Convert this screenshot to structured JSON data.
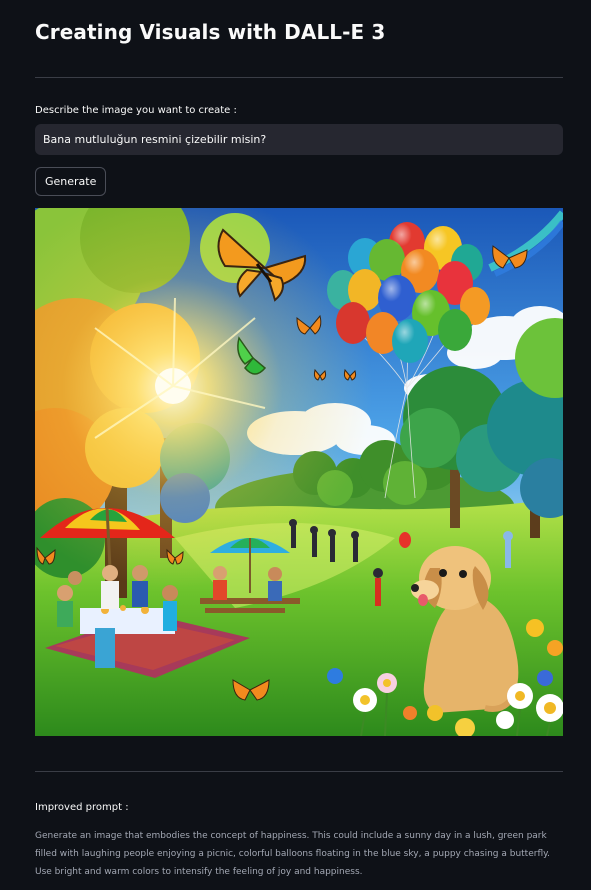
{
  "header": {
    "title": "Creating Visuals with DALL-E 3"
  },
  "prompt_input": {
    "label": "Describe the image you want to create :",
    "value": "Bana mutluluğun resmini çizebilir misin?"
  },
  "actions": {
    "generate_label": "Generate"
  },
  "result": {
    "improved_prompt_label": "Improved prompt :",
    "improved_prompt_text": "Generate an image that embodies the concept of happiness. This could include a sunny day in a lush, green park filled with laughing people enjoying a picnic, colorful balloons floating in the blue sky, a puppy chasing a butterfly. Use bright and warm colors to intensify the feeling of joy and happiness."
  },
  "colors": {
    "background": "#0e1117",
    "input_background": "#262730",
    "text": "#fafafa",
    "muted_text": "#a3a8b4",
    "divider": "#3a3d46"
  },
  "icons": {
    "generated_image": "generated-image"
  }
}
